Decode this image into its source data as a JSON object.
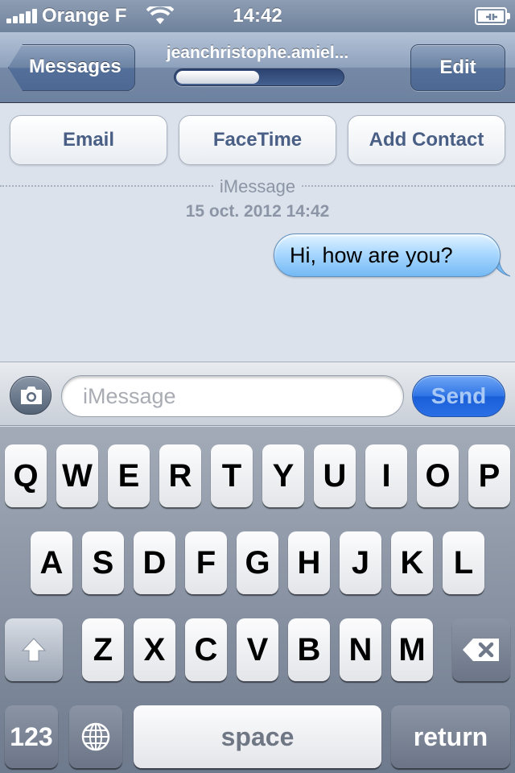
{
  "status_bar": {
    "carrier": "Orange F",
    "time": "14:42",
    "icons": [
      "signal-bars-icon",
      "wifi-icon",
      "battery-charging-icon"
    ]
  },
  "nav": {
    "back_label": "Messages",
    "title": "jeanchristophe.amiel...",
    "send_progress": 0.5,
    "edit_label": "Edit"
  },
  "contact_actions": {
    "email": "Email",
    "facetime": "FaceTime",
    "add_contact": "Add Contact"
  },
  "conversation": {
    "service": "iMessage",
    "date": "15 oct. 2012 14:42",
    "messages": [
      {
        "from": "me",
        "text": "Hi, how are you?"
      }
    ]
  },
  "composer": {
    "camera_icon": "camera-icon",
    "placeholder": "iMessage",
    "value": "",
    "send_label": "Send"
  },
  "keyboard": {
    "row1": [
      "Q",
      "W",
      "E",
      "R",
      "T",
      "Y",
      "U",
      "I",
      "O",
      "P"
    ],
    "row2": [
      "A",
      "S",
      "D",
      "F",
      "G",
      "H",
      "J",
      "K",
      "L"
    ],
    "row3": [
      "Z",
      "X",
      "C",
      "V",
      "B",
      "N",
      "M"
    ],
    "shift_icon": "shift-arrow-icon",
    "delete_icon": "backspace-icon",
    "numbers_label": "123",
    "globe_icon": "globe-icon",
    "space_label": "space",
    "return_label": "return"
  },
  "colors": {
    "bubble_blue": "#a9d8ff",
    "nav_blue": "#6d82a0",
    "send_blue": "#2f74e6",
    "link_text": "#4a5f85"
  }
}
